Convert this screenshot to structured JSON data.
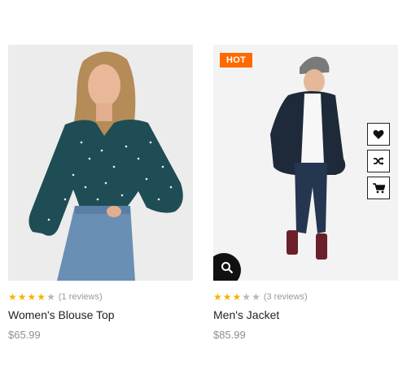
{
  "products": [
    {
      "name": "Women's Blouse Top",
      "price": "$65.99",
      "rating": 4,
      "rating_max": 5,
      "reviews": "(1 reviews)"
    },
    {
      "name": "Men's Jacket",
      "price": "$85.99",
      "rating": 3,
      "rating_max": 5,
      "reviews": "(3 reviews)",
      "badge": "HOT",
      "actions": [
        "heart-icon",
        "shuffle-icon",
        "cart-icon"
      ],
      "quick_view_icon": "search-icon"
    }
  ],
  "colors": {
    "star_on": "#f5b301",
    "star_off": "#b8b8b8",
    "badge": "#ff6a00"
  }
}
